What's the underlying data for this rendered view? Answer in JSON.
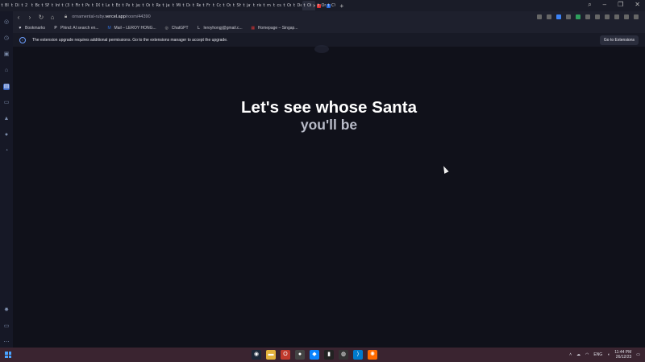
{
  "browser": {
    "tabs": [
      {
        "label": "Bl",
        "icon": "tab-icon"
      },
      {
        "label": "Di",
        "icon": "t-icon"
      },
      {
        "label": "2 r",
        "icon": "t-icon"
      },
      {
        "label": "Bc",
        "icon": "t-icon"
      },
      {
        "label": "SF",
        "icon": "t-icon"
      },
      {
        "label": "Int",
        "icon": "t-icon"
      },
      {
        "label": "(3)",
        "icon": "t-icon"
      },
      {
        "label": "Fir",
        "icon": "t-icon"
      },
      {
        "label": "Pe",
        "icon": "t-icon"
      },
      {
        "label": "DC",
        "icon": "t-icon"
      },
      {
        "label": "Le",
        "icon": "t-icon"
      },
      {
        "label": "Ed",
        "icon": "t-icon"
      },
      {
        "label": "Pa",
        "icon": "t-icon"
      },
      {
        "label": "jax",
        "icon": "t-icon"
      },
      {
        "label": "Or",
        "icon": "t-icon"
      },
      {
        "label": "Re",
        "icon": "t-icon"
      },
      {
        "label": "jas",
        "icon": "t-icon"
      },
      {
        "label": "Mi",
        "icon": "t-icon"
      },
      {
        "label": "De",
        "icon": "t-icon"
      },
      {
        "label": "Re",
        "icon": "t-icon"
      },
      {
        "label": "Fr",
        "icon": "t-icon"
      },
      {
        "label": "Co",
        "icon": "t-icon"
      },
      {
        "label": "Or",
        "icon": "t-icon"
      },
      {
        "label": "Sh",
        "icon": "t-icon"
      },
      {
        "label": "jav",
        "icon": "t-icon"
      },
      {
        "label": "rie",
        "icon": "t-icon"
      },
      {
        "label": "mu",
        "icon": "t-icon"
      },
      {
        "label": "css",
        "icon": "t-icon"
      },
      {
        "label": "Or",
        "icon": "t-icon"
      },
      {
        "label": "De",
        "icon": "t-icon"
      },
      {
        "label": "Oi",
        "icon": "t-icon",
        "active": true
      },
      {
        "label": "On",
        "icon": "t-icon",
        "style": "red"
      },
      {
        "label": "CV",
        "icon": "t-icon",
        "style": "blue"
      }
    ],
    "new_tab": "+",
    "url_prefix": "ornamental-ruby.",
    "url_domain": "vercel.app",
    "url_path": "/room/44390"
  },
  "bookmarks": [
    {
      "label": "Bookmarks",
      "icon": "heart-icon"
    },
    {
      "label": "Phind: AI search en...",
      "icon": "p-icon"
    },
    {
      "label": "Mail – LEROY HONG...",
      "icon": "mail-icon"
    },
    {
      "label": "ChatGPT",
      "icon": "chatgpt-icon"
    },
    {
      "label": "leroyhongj@gmail.c...",
      "icon": "l-icon"
    },
    {
      "label": "Homepage – Singap...",
      "icon": "homepage-icon"
    }
  ],
  "infobar": {
    "message": "The extension upgrade requires additional permissions. Go to the extensions manager to accept the upgrade.",
    "button": "Go to Extensions"
  },
  "page": {
    "heading_line1": "Let's see whose Santa",
    "heading_line2": "you'll be"
  },
  "taskbar": {
    "language": "ENG",
    "time": "11:44 PM",
    "date": "26/12/23"
  }
}
